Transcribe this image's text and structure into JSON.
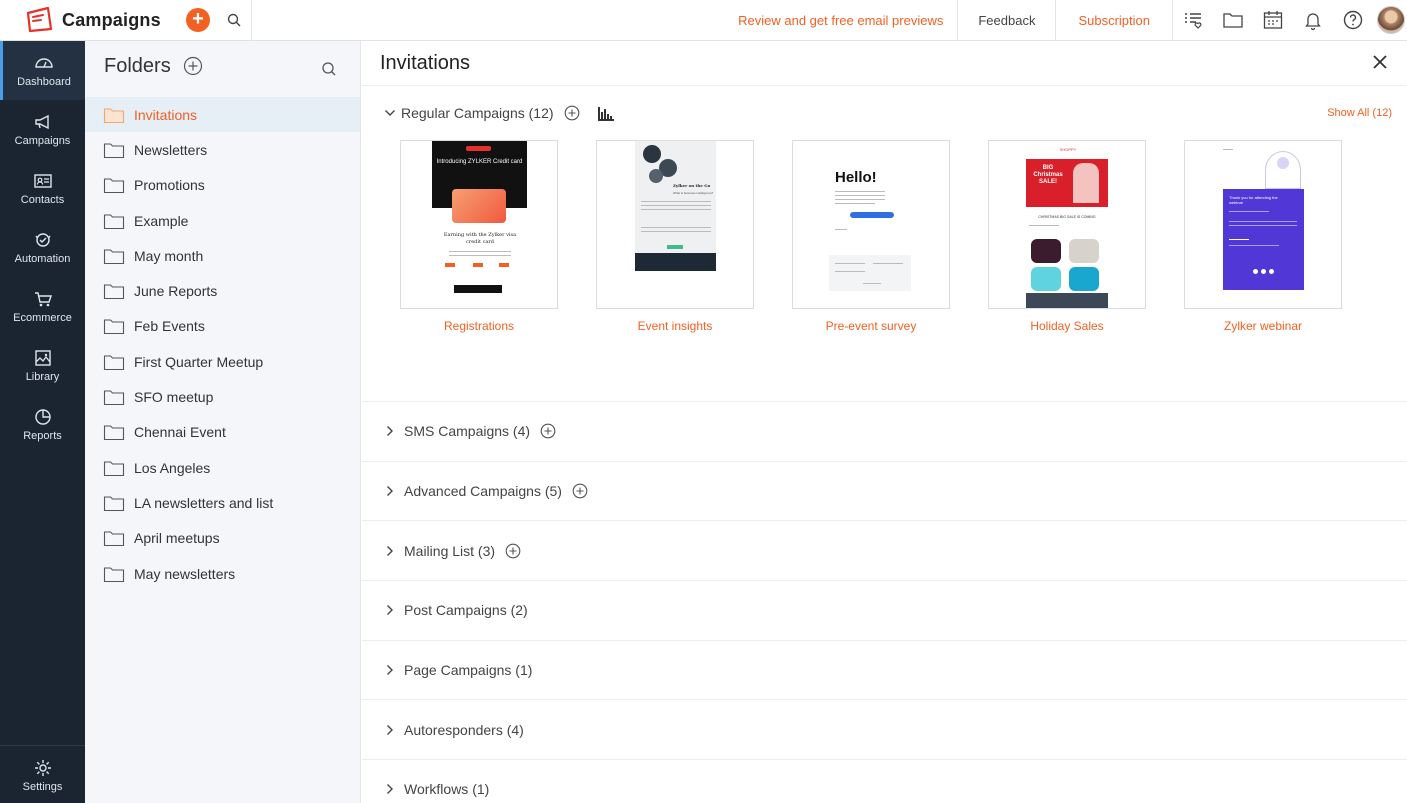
{
  "app": {
    "title": "Campaigns"
  },
  "topbar": {
    "review_link": "Review and get free email previews",
    "feedback": "Feedback",
    "subscription": "Subscription"
  },
  "rail": {
    "items": [
      {
        "label": "Dashboard",
        "icon": "dashboard-icon"
      },
      {
        "label": "Campaigns",
        "icon": "megaphone-icon"
      },
      {
        "label": "Contacts",
        "icon": "contact-card-icon"
      },
      {
        "label": "Automation",
        "icon": "automation-icon"
      },
      {
        "label": "Ecommerce",
        "icon": "cart-icon"
      },
      {
        "label": "Library",
        "icon": "image-library-icon"
      },
      {
        "label": "Reports",
        "icon": "pie-chart-icon"
      }
    ],
    "settings": "Settings"
  },
  "folders": {
    "title": "Folders",
    "items": [
      "Invitations",
      "Newsletters",
      "Promotions",
      "Example",
      "May month",
      "June Reports",
      "Feb Events",
      "First Quarter Meetup",
      "SFO meetup",
      "Chennai Event",
      "Los Angeles",
      "LA newsletters and list",
      "April meetups",
      "May newsletters"
    ]
  },
  "main": {
    "title": "Invitations",
    "regular": {
      "label": "Regular Campaigns (12)",
      "show_all": "Show All (12)",
      "cards": [
        {
          "label": "Registrations",
          "headline": "Introducing ZYLKER Credit card",
          "sub": "Earning with the Zylker visa credit card"
        },
        {
          "label": "Event insights",
          "headline": "Zylker on the Go",
          "sub": "What is business intelligence?"
        },
        {
          "label": "Pre-event survey",
          "headline": "Hello!"
        },
        {
          "label": "Holiday Sales",
          "headline": "BIG Christmas SALE!",
          "sub": "CHRISTMAS BIG SALE IS COMING"
        },
        {
          "label": "Zylker webinar",
          "headline": "Thank you for attending the webinar"
        }
      ]
    },
    "sections": [
      {
        "label": "SMS Campaigns (4)",
        "has_add": true
      },
      {
        "label": "Advanced Campaigns (5)",
        "has_add": true
      },
      {
        "label": "Mailing List (3)",
        "has_add": true
      },
      {
        "label": "Post Campaigns (2)",
        "has_add": false
      },
      {
        "label": "Page Campaigns (1)",
        "has_add": false
      },
      {
        "label": "Autoresponders (4)",
        "has_add": false
      },
      {
        "label": "Workflows (1)",
        "has_add": false
      }
    ]
  },
  "colors": {
    "accent": "#f26122",
    "rail_bg": "#1b2531",
    "folder_bg": "#f4f6f9",
    "active_indicator": "#4a9ee8"
  }
}
